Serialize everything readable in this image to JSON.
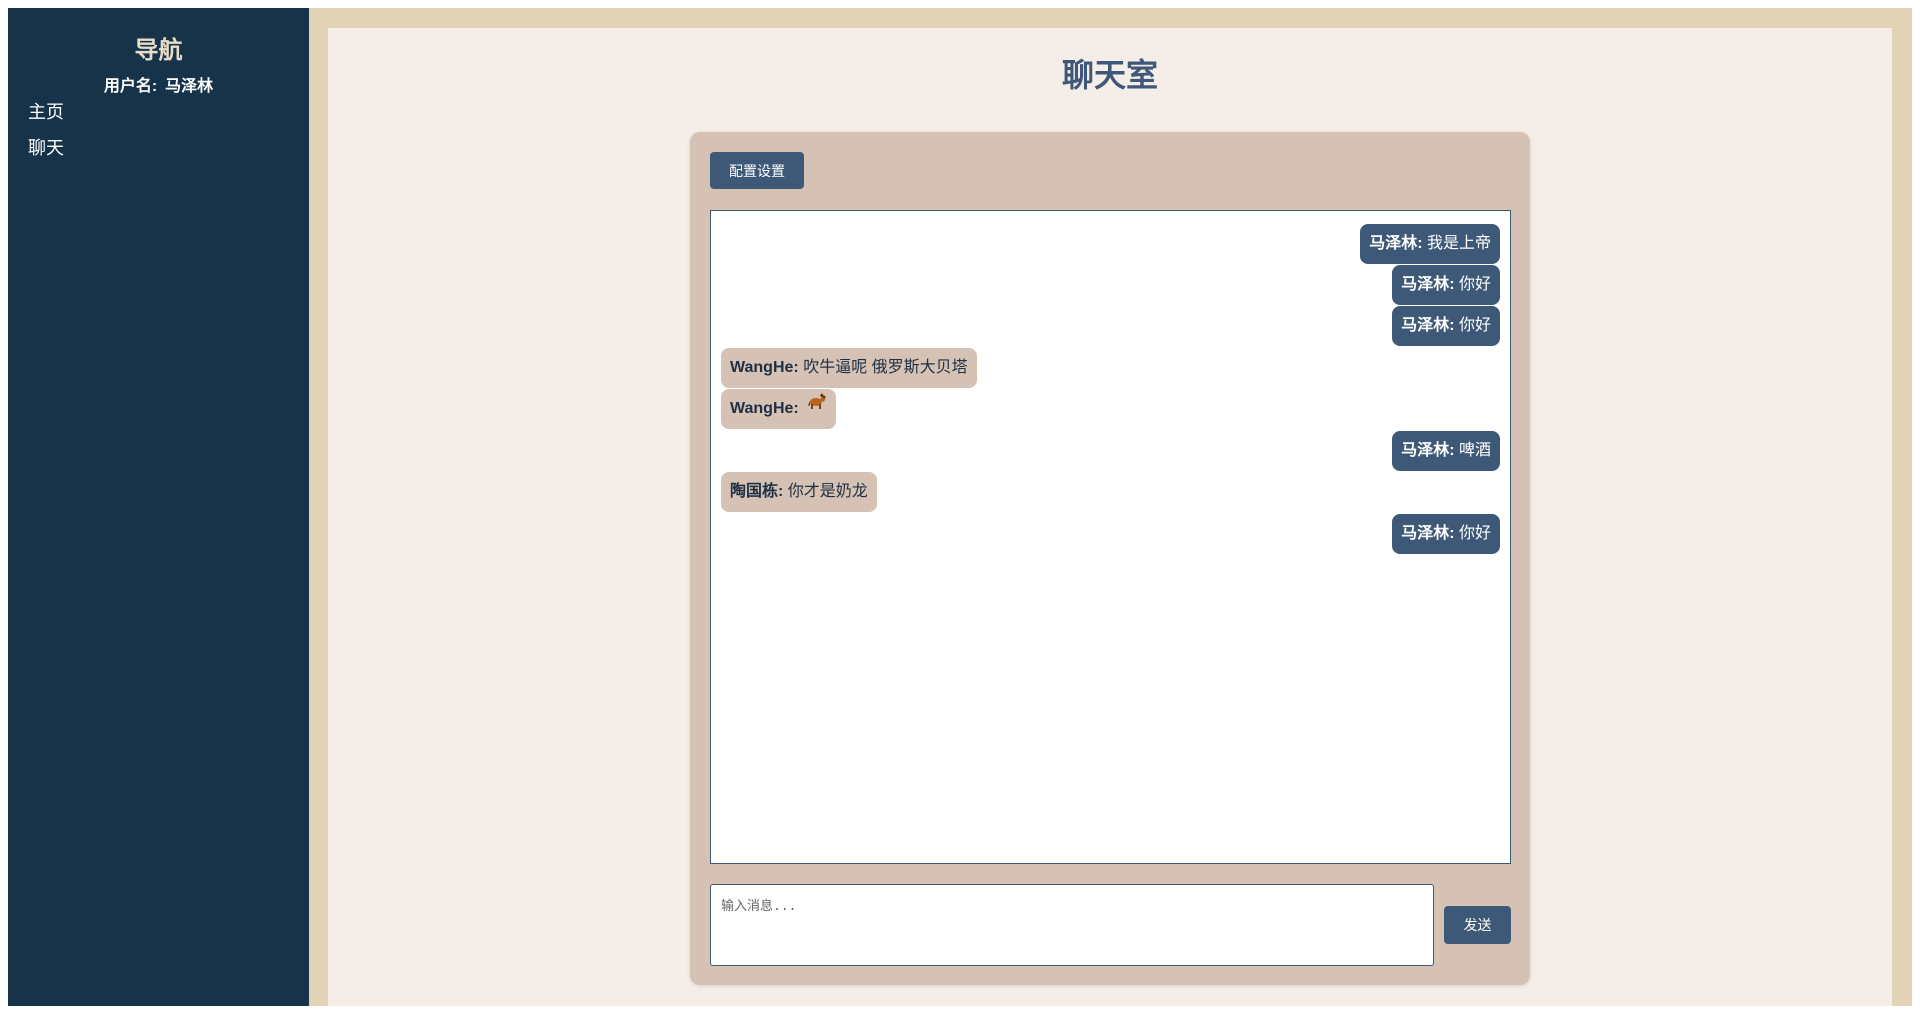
{
  "sidebar": {
    "title": "导航",
    "user_label": "用户名:",
    "username": "马泽林",
    "items": [
      {
        "label": "主页"
      },
      {
        "label": "聊天"
      }
    ]
  },
  "main": {
    "title": "聊天室",
    "config_button": "配置设置",
    "input_placeholder": "输入消息...",
    "send_button": "发送"
  },
  "messages": [
    {
      "sender": "马泽林",
      "text": "我是上帝",
      "mine": true
    },
    {
      "sender": "马泽林",
      "text": "你好",
      "mine": true
    },
    {
      "sender": "马泽林",
      "text": "你好",
      "mine": true
    },
    {
      "sender": "WangHe",
      "text": "吹牛逼呢 俄罗斯大贝塔",
      "mine": false
    },
    {
      "sender": "WangHe",
      "text": "",
      "icon": "horse-emoji-icon",
      "mine": false
    },
    {
      "sender": "马泽林",
      "text": "啤酒",
      "mine": true
    },
    {
      "sender": "陶国栋",
      "text": "你才是奶龙",
      "mine": false
    },
    {
      "sender": "马泽林",
      "text": "你好",
      "mine": true
    }
  ],
  "colors": {
    "sidebar_bg": "#163349",
    "accent": "#3e5877",
    "panel_bg": "#d6c2b5",
    "page_bg": "#f5eee8",
    "frame_bg": "#e2d2b6"
  }
}
